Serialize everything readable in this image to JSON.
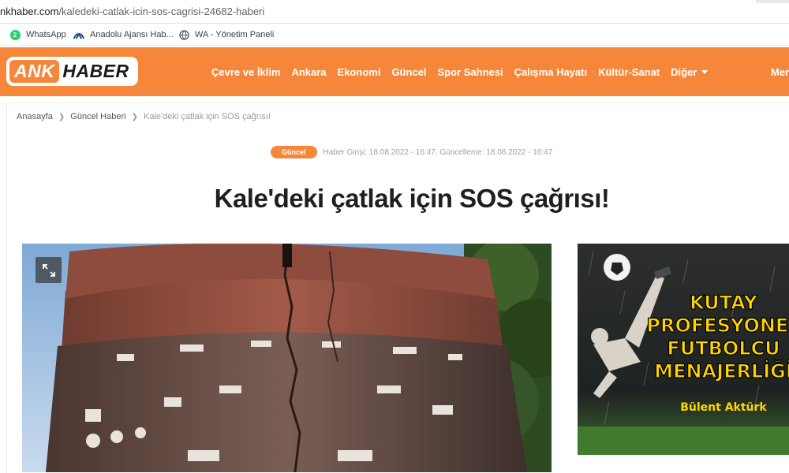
{
  "browser": {
    "url_host": "nkhaber.com",
    "url_path": "/kaledeki-catlak-icin-sos-cagrisi-24682-haberi"
  },
  "bookmarks": [
    {
      "label": "WhatsApp",
      "badge": "2",
      "icon": "whatsapp-icon"
    },
    {
      "label": "Anadolu Ajansı Hab...",
      "icon": "anadolu-ajansi-icon"
    },
    {
      "label": "WA - Yönetim Paneli",
      "icon": "globe-icon"
    }
  ],
  "site": {
    "logo_left": "ANK",
    "logo_right": "HABER",
    "nav": [
      "Çevre ve İklim",
      "Ankara",
      "Ekonomi",
      "Güncel",
      "Spor Sahnesi",
      "Çalışma Hayatı",
      "Kültür-Sanat",
      "Diğer"
    ],
    "nav_cut": "Men",
    "brand_color": "#f6873a"
  },
  "breadcrumb": {
    "home": "Anasayfa",
    "category": "Güncel Haberi",
    "current": "Kale'deki çatlak için SOS çağrısı!"
  },
  "article": {
    "category_badge": "Güncel",
    "dates": "Haber Girişi: 18.08.2022 - 16:47, Güncelleme: 18.08.2022 - 16:47",
    "title": "Kale'deki çatlak için SOS çağrısı!"
  },
  "ad": {
    "line1": "KUTAY",
    "line2": "PROFESYONEL",
    "line3": "FUTBOLCU",
    "line4": "MENAJERLİĞİ",
    "signature": "Bülent Aktürk"
  }
}
